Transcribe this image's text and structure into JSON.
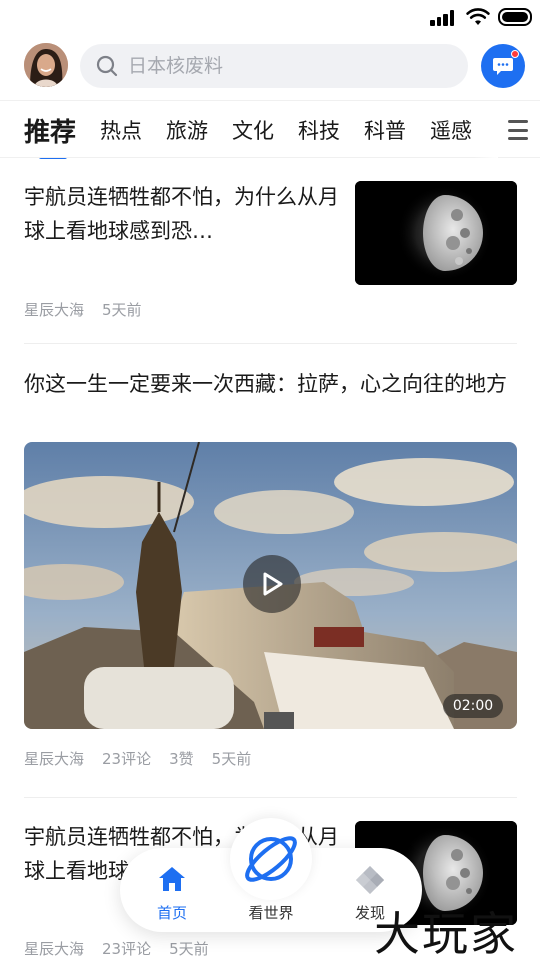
{
  "status_bar": {
    "signal_icon": "signal-icon",
    "wifi_icon": "wifi-icon",
    "battery_icon": "battery-icon"
  },
  "header": {
    "avatar": "user-avatar",
    "search": {
      "placeholder": "日本核废料",
      "icon": "search-icon"
    },
    "message_icon": "message-icon"
  },
  "tabs": {
    "items": [
      {
        "label": "推荐",
        "active": true
      },
      {
        "label": "热点"
      },
      {
        "label": "旅游"
      },
      {
        "label": "文化"
      },
      {
        "label": "科技"
      },
      {
        "label": "科普"
      },
      {
        "label": "遥感"
      }
    ],
    "more_icon": "menu-icon"
  },
  "feed": [
    {
      "title": "宇航员连牺牲都不怕，为什么从月球上看地球感到恐…",
      "meta": {
        "source": "星辰大海",
        "time": "5天前"
      },
      "thumbnail": "moon-image"
    },
    {
      "title": "你这一生一定要来一次西藏：拉萨，心之向往的地方",
      "video": {
        "duration": "02:00",
        "image": "potala-palace-image",
        "play_icon": "play-icon"
      },
      "meta": {
        "source": "星辰大海",
        "comments": "23评论",
        "likes": "3赞",
        "time": "5天前"
      }
    },
    {
      "title": "宇航员连牺牲都不怕，为什么从月球上看地球感到恐…",
      "meta": {
        "source": "星辰大海",
        "comments": "23评论",
        "time": "5天前"
      },
      "thumbnail": "moon-image"
    }
  ],
  "bottom_nav": {
    "items": [
      {
        "label": "首页",
        "icon": "home-icon",
        "active": true
      },
      {
        "label": "看世界",
        "icon": "planet-icon"
      },
      {
        "label": "发现",
        "icon": "discover-icon"
      }
    ]
  },
  "watermark": "大玩家",
  "colors": {
    "accent": "#1e6ff1",
    "text": "#1a1a1a",
    "meta": "#9a9da3",
    "badge": "#ff3b3b"
  }
}
